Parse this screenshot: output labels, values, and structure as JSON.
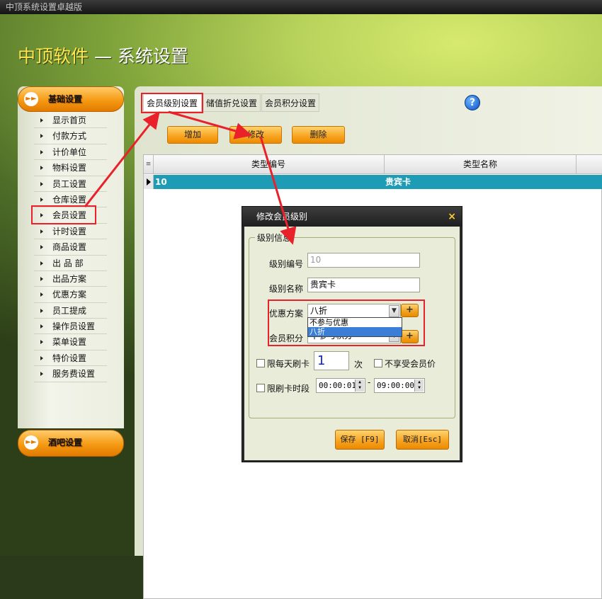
{
  "window": {
    "title": "中顶系统设置卓越版"
  },
  "header": {
    "brand": "中顶软件",
    "suffix": " — 系统设置"
  },
  "sidebar": {
    "section1": "基础设置",
    "section2": "酒吧设置",
    "items": [
      "显示首页",
      "付款方式",
      "计价单位",
      "物料设置",
      "员工设置",
      "仓库设置",
      "会员设置",
      "计时设置",
      "商品设置",
      "出 品 部",
      "出品方案",
      "优惠方案",
      "员工提成",
      "操作员设置",
      "菜单设置",
      "特价设置",
      "服务费设置"
    ]
  },
  "tabs": [
    "会员级别设置",
    "储值折兑设置",
    "会员积分设置"
  ],
  "toolbar": {
    "add": "增加",
    "edit": "修改",
    "delete": "删除"
  },
  "grid": {
    "columns": [
      "类型编号",
      "类型名称"
    ],
    "rows": [
      {
        "code": "10",
        "name": "贵宾卡"
      }
    ]
  },
  "dialog": {
    "title": "修改会员级别",
    "close": "×",
    "group": "级别信息",
    "code_label": "级别编号",
    "code_value": "10",
    "name_label": "级别名称",
    "name_value": "贵宾卡",
    "discount_label": "优惠方案",
    "discount_value": "八折",
    "discount_options": [
      "不参与优惠",
      "八折"
    ],
    "points_label": "会员积分",
    "points_value": "不参与积分",
    "plus": "+",
    "daily_limit_label": "限每天刷卡",
    "daily_limit_value": "1",
    "times_unit": "次",
    "no_member_price_label": "不享受会员价",
    "time_limit_label": "限刷卡时段",
    "time_start": "00:00:01",
    "time_sep": "-",
    "time_end": "09:00:00",
    "save": "保存 [F9]",
    "cancel": "取消[Esc]"
  },
  "colors": {
    "accent": "#f59a13",
    "selection": "#1e9bb5",
    "annotation": "#e8212b"
  }
}
